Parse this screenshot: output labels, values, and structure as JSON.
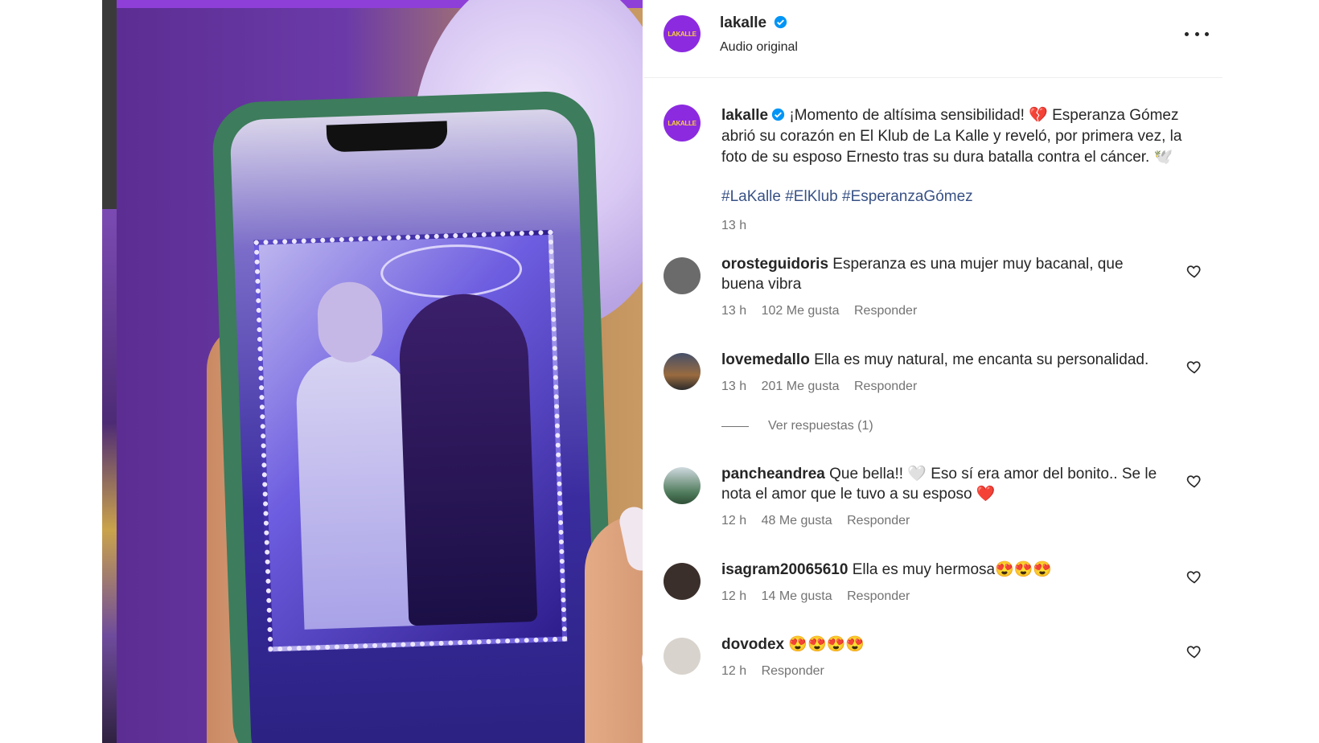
{
  "post": {
    "username": "lakalle",
    "subtitle": "Audio original",
    "avatar_text": "LAKALLE",
    "caption_lines": [
      "¡Momento de altísima sensibilidad! 💔 Esperanza Gómez",
      "abrió su corazón en El Klub de La Kalle y reveló, por primera vez, la",
      "foto de su esposo Ernesto tras su dura batalla contra el cáncer. 🕊️"
    ],
    "hashtags": [
      "#LaKalle",
      "#ElKlub",
      "#EsperanzaGómez"
    ],
    "time": "13 h"
  },
  "comments": [
    {
      "user": "orosteguidoris",
      "text": "Esperanza es una mujer muy bacanal, que",
      "text2": "buena vibra",
      "time": "13 h",
      "likes": "102 Me gusta",
      "reply": "Responder",
      "avatar_color": "#6b6b6b"
    },
    {
      "user": "lovemedallo",
      "text": "Ella es muy natural, me encanta su personalidad.",
      "time": "13 h",
      "likes": "201 Me gusta",
      "reply": "Responder",
      "avatar_color": "#9a6b3f"
    },
    {
      "user": "pancheandrea",
      "text": "Que bella!! 🤍  Eso sí era amor del bonito.. Se le",
      "text2": "nota el amor que le tuvo a su esposo ❤️",
      "time": "12 h",
      "likes": "48 Me gusta",
      "reply": "Responder",
      "avatar_color": "#4e7a5a"
    },
    {
      "user": "isagram20065610",
      "text": "Ella es muy hermosa😍😍😍",
      "time": "12 h",
      "likes": "14 Me gusta",
      "reply": "Responder",
      "avatar_color": "#3a2f2a"
    },
    {
      "user": "dovodex",
      "text": "😍😍😍😍",
      "time": "12 h",
      "reply": "Responder",
      "avatar_color": "#d8d3cc"
    }
  ],
  "view_replies": "Ver respuestas (1)",
  "colors": {
    "link": "#385185",
    "meta": "#737373",
    "brand": "#8c2ae0"
  }
}
